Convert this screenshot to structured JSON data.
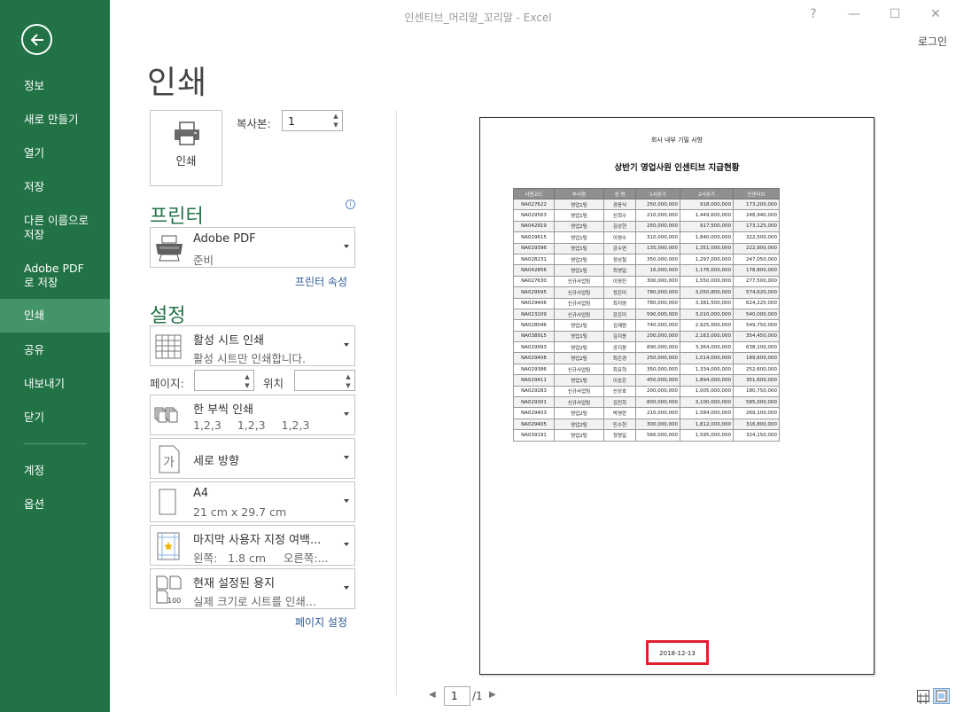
{
  "window": {
    "title": "인센티브_머리말_꼬리말 - Excel",
    "help": "?",
    "minimize": "—",
    "maximize": "☐",
    "close": "✕",
    "login": "로그인"
  },
  "sidebar": {
    "items": [
      {
        "label": "정보"
      },
      {
        "label": "새로 만들기"
      },
      {
        "label": "열기"
      },
      {
        "label": "저장"
      },
      {
        "label": "다른 이름으로 저장"
      },
      {
        "label": "Adobe PDF로 저장"
      },
      {
        "label": "인쇄",
        "active": true
      },
      {
        "label": "공유"
      },
      {
        "label": "내보내기"
      },
      {
        "label": "닫기"
      },
      {
        "label": "계정"
      },
      {
        "label": "옵션"
      }
    ]
  },
  "page_title": "인쇄",
  "print_button": {
    "label": "인쇄"
  },
  "copies": {
    "label": "복사본:",
    "value": "1"
  },
  "printer": {
    "heading": "프린터",
    "name": "Adobe PDF",
    "status": "준비",
    "properties_link": "프린터 속성"
  },
  "settings": {
    "heading": "설정",
    "what": {
      "title": "활성 시트 인쇄",
      "desc": "활성 시트만 인쇄합니다."
    },
    "pages_label": "페이지:",
    "to_label": "위치",
    "collate": {
      "title": "한 부씩 인쇄",
      "seq": [
        "1,2,3",
        "1,2,3",
        "1,2,3"
      ]
    },
    "orientation": {
      "title": "세로 방향",
      "icon_char": "가"
    },
    "paper": {
      "title": "A4",
      "desc": "21 cm x 29.7 cm"
    },
    "margins": {
      "title": "마지막 사용자 지정 여백...",
      "desc": "왼쪽:   1.8 cm     오른쪽:..."
    },
    "scaling": {
      "title": "현재 설정된 용지",
      "desc": "실제 크기로 시트를 인쇄...",
      "icon_text": "100"
    },
    "page_setup_link": "페이지 설정"
  },
  "preview": {
    "confidential": "회사 내부 기밀 사항",
    "title": "상반기 영업사원 인센티브 지급현황",
    "headers": [
      "사원코드",
      "부서명",
      "성  명",
      "1사분기",
      "2사분기",
      "인센티브"
    ],
    "rows": [
      [
        "NA027622",
        "영업1팀",
        "경윤식",
        "250,000,000",
        "918,000,000",
        "173,200,000"
      ],
      [
        "NA029563",
        "영업1팀",
        "신희수",
        "210,000,000",
        "1,449,600,000",
        "248,940,000"
      ],
      [
        "NA042919",
        "영업2팀",
        "김상현",
        "250,000,000",
        "917,500,000",
        "173,125,000"
      ],
      [
        "NA029615",
        "영업1팀",
        "이영수",
        "310,000,000",
        "1,840,000,000",
        "322,500,000"
      ],
      [
        "NA029396",
        "영업1팀",
        "강수연",
        "135,000,000",
        "1,351,000,000",
        "222,900,000"
      ],
      [
        "NA028231",
        "영업2팀",
        "정상철",
        "350,000,000",
        "1,297,000,000",
        "247,050,000"
      ],
      [
        "NA042856",
        "영업1팀",
        "최영일",
        "16,000,000",
        "1,176,000,000",
        "178,800,000"
      ],
      [
        "NA027630",
        "신규사업팀",
        "이영진",
        "300,000,000",
        "1,550,000,000",
        "277,500,000"
      ],
      [
        "NA029595",
        "신규사업팀",
        "정은미",
        "780,000,000",
        "3,050,800,000",
        "574,620,000"
      ],
      [
        "NA029406",
        "신규사업팀",
        "최지영",
        "780,000,000",
        "3,381,500,000",
        "624,225,000"
      ],
      [
        "NA023109",
        "신규사업팀",
        "강은미",
        "590,000,000",
        "3,010,000,000",
        "540,000,000"
      ],
      [
        "NA028046",
        "영업2팀",
        "김재원",
        "740,000,000",
        "2,925,000,000",
        "549,750,000"
      ],
      [
        "NA038915",
        "영업1팀",
        "김지윤",
        "200,000,000",
        "2,163,000,000",
        "354,450,000"
      ],
      [
        "NA029993",
        "영업2팀",
        "공지윤",
        "890,000,000",
        "3,364,000,000",
        "638,100,000"
      ],
      [
        "NA029408",
        "영업2팀",
        "최은경",
        "250,000,000",
        "1,014,000,000",
        "189,600,000"
      ],
      [
        "NA029386",
        "신규사업팀",
        "최유혁",
        "350,000,000",
        "1,334,000,000",
        "252,600,000"
      ],
      [
        "NA029411",
        "영업1팀",
        "이승은",
        "450,000,000",
        "1,894,000,000",
        "351,600,000"
      ],
      [
        "NA029283",
        "신규사업팀",
        "신상호",
        "200,000,000",
        "1,005,000,000",
        "180,750,000"
      ],
      [
        "NA029301",
        "신규사업팀",
        "김진희",
        "800,000,000",
        "3,100,000,000",
        "585,000,000"
      ],
      [
        "NA029403",
        "영업2팀",
        "박영란",
        "210,000,000",
        "1,584,000,000",
        "269,100,000"
      ],
      [
        "NA029405",
        "영업2팀",
        "민수현",
        "300,000,000",
        "1,812,000,000",
        "316,800,000"
      ],
      [
        "NA039191",
        "영업2팀",
        "정명일",
        "566,000,000",
        "1,595,000,000",
        "324,150,000"
      ]
    ],
    "footer_date": "2018-12-13"
  },
  "pager": {
    "prev": "◀",
    "current": "1",
    "total": "/1",
    "next": "▶"
  },
  "colors": {
    "brand": "#217346",
    "sidebar_active": "#439467",
    "highlight": "#e0202c"
  }
}
